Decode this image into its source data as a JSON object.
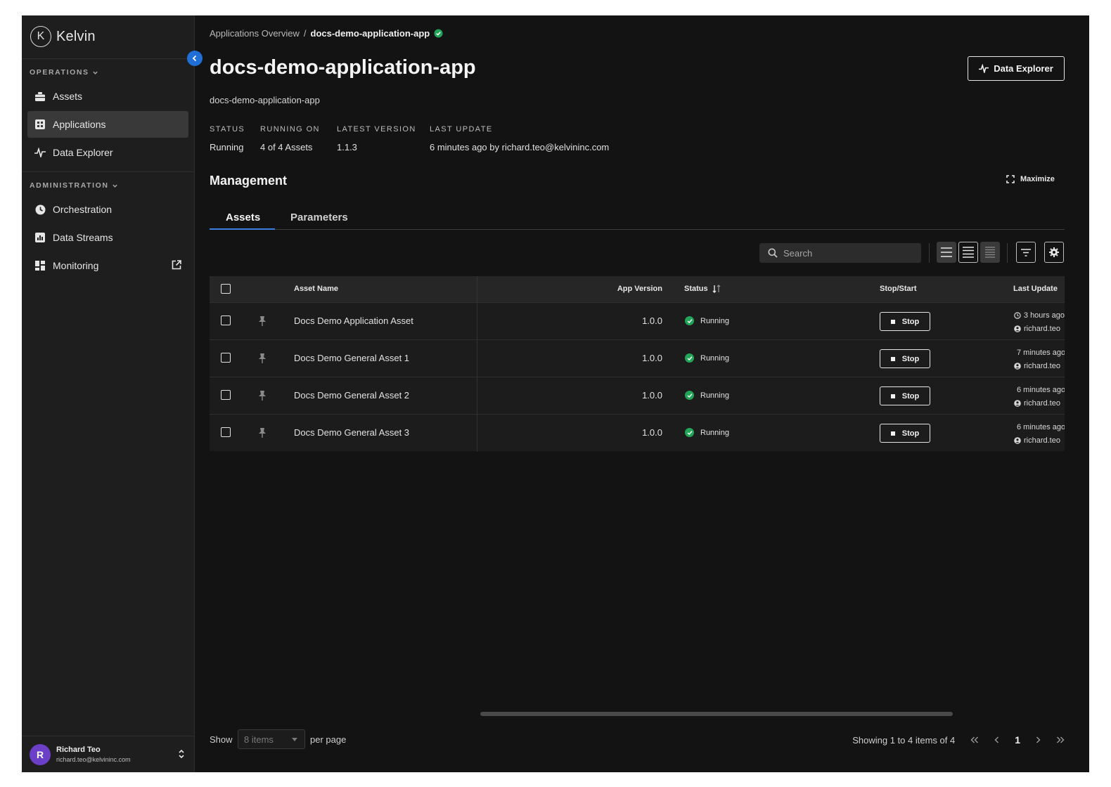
{
  "app": {
    "name": "Kelvin",
    "logo_letter": "K"
  },
  "sidebar": {
    "operations_title": "OPERATIONS",
    "administration_title": "ADMINISTRATION",
    "operations_items": [
      {
        "label": "Assets",
        "icon": "assets-icon"
      },
      {
        "label": "Applications",
        "icon": "applications-icon",
        "active": true
      },
      {
        "label": "Data Explorer",
        "icon": "pulse-icon"
      }
    ],
    "administration_items": [
      {
        "label": "Orchestration",
        "icon": "orchestration-icon"
      },
      {
        "label": "Data Streams",
        "icon": "data-streams-icon"
      },
      {
        "label": "Monitoring",
        "icon": "monitoring-icon",
        "external": true
      }
    ]
  },
  "user": {
    "initial": "R",
    "name": "Richard Teo",
    "email": "richard.teo@kelvininc.com"
  },
  "breadcrumb": {
    "parent": "Applications Overview",
    "separator": "/",
    "current": "docs-demo-application-app"
  },
  "page": {
    "title": "docs-demo-application-app",
    "subtitle": "docs-demo-application-app",
    "data_explorer_label": "Data Explorer"
  },
  "meta": {
    "status_label": "STATUS",
    "status_value": "Running",
    "running_on_label": "RUNNING ON",
    "running_on_value": "4 of 4 Assets",
    "latest_version_label": "LATEST VERSION",
    "latest_version_value": "1.1.3",
    "last_update_label": "LAST UPDATE",
    "last_update_value": "6 minutes ago by richard.teo@kelvininc.com"
  },
  "management": {
    "title": "Management",
    "maximize_label": "Maximize"
  },
  "tabs": [
    {
      "label": "Assets",
      "active": true
    },
    {
      "label": "Parameters"
    }
  ],
  "toolbar": {
    "search_placeholder": "Search"
  },
  "table": {
    "headers": {
      "asset_name": "Asset Name",
      "app_version": "App Version",
      "status": "Status",
      "stop_start": "Stop/Start",
      "last_update": "Last Update"
    },
    "stop_label": "Stop",
    "rows": [
      {
        "asset_name": "Docs Demo Application Asset",
        "app_version": "1.0.0",
        "status": "Running",
        "updated": "3 hours ago",
        "user": "richard.teo"
      },
      {
        "asset_name": "Docs Demo General Asset 1",
        "app_version": "1.0.0",
        "status": "Running",
        "updated": "7 minutes ago",
        "user": "richard.teo"
      },
      {
        "asset_name": "Docs Demo General Asset 2",
        "app_version": "1.0.0",
        "status": "Running",
        "updated": "6 minutes ago",
        "user": "richard.teo"
      },
      {
        "asset_name": "Docs Demo General Asset 3",
        "app_version": "1.0.0",
        "status": "Running",
        "updated": "6 minutes ago",
        "user": "richard.teo"
      }
    ]
  },
  "footer": {
    "show_label": "Show",
    "per_page_value": "8 items",
    "per_page_label": "per page",
    "showing_text": "Showing 1 to 4 items of 4",
    "current_page": "1"
  },
  "colors": {
    "background": "#131313",
    "sidebar": "#1e1e1e",
    "accent": "#1f6fd6",
    "success": "#23a559"
  }
}
